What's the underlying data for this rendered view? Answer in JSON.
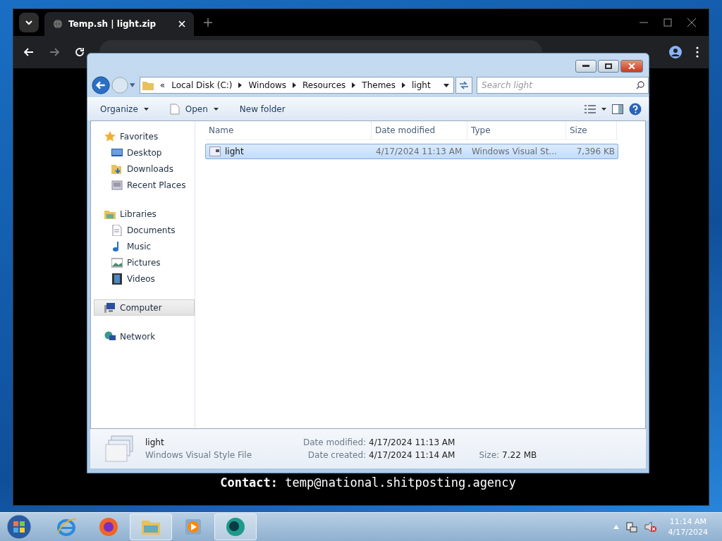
{
  "browser": {
    "tab": {
      "title": "Temp.sh | light.zip",
      "selected": true
    },
    "contact": "**Contact:** temp@national.shitposting.agency"
  },
  "explorer": {
    "overflow": "«",
    "breadcrumbs": [
      "Local Disk (C:)",
      "Windows",
      "Resources",
      "Themes",
      "light"
    ],
    "search": {
      "placeholder": "Search light"
    },
    "toolbar": [
      {
        "label": "Organize",
        "kind": "menu"
      },
      {
        "label": "Open",
        "kind": "open"
      },
      {
        "label": "New folder",
        "kind": "plain"
      }
    ],
    "nav": [
      {
        "label": "Favorites",
        "selected": false,
        "children": [
          {
            "label": "Desktop",
            "selected": false
          },
          {
            "label": "Downloads",
            "selected": false
          },
          {
            "label": "Recent Places",
            "selected": false
          }
        ]
      },
      {
        "label": "Libraries",
        "selected": false,
        "children": [
          {
            "label": "Documents",
            "selected": false
          },
          {
            "label": "Music",
            "selected": false
          },
          {
            "label": "Pictures",
            "selected": false
          },
          {
            "label": "Videos",
            "selected": false
          }
        ]
      },
      {
        "label": "Computer",
        "selected": true
      },
      {
        "label": "Network",
        "selected": false
      }
    ],
    "columns": [
      "Name",
      "Date modified",
      "Type",
      "Size"
    ],
    "rows": [
      {
        "name": "light",
        "date": "4/17/2024 11:13 AM",
        "type": "Windows Visual St...",
        "size": "7,396 KB",
        "selected": true
      }
    ],
    "details": {
      "name": "light",
      "type": "Windows Visual Style File",
      "fields": [
        {
          "label": "Date modified:",
          "value": "4/17/2024 11:13 AM"
        },
        {
          "label": "Date created:",
          "value": "4/17/2024 11:14 AM"
        },
        {
          "label": "Size:",
          "value": "7.22 MB"
        }
      ]
    }
  },
  "taskbar": {
    "apps": [
      {
        "kind": "ie",
        "running": false
      },
      {
        "kind": "firefox",
        "running": false
      },
      {
        "kind": "explorer",
        "running": true
      },
      {
        "kind": "media",
        "running": false
      },
      {
        "kind": "app",
        "running": true
      }
    ],
    "time": "11:14 AM",
    "date": "4/17/2024"
  }
}
